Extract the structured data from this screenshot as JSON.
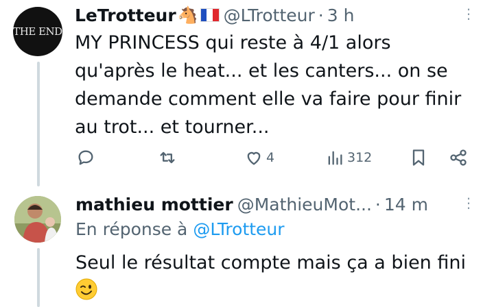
{
  "tweet1": {
    "avatar_text": "THE END",
    "display_name": "LeTrotteur",
    "name_emoji": "🐴",
    "handle": "@LTrotteur",
    "separator": "·",
    "time": "3 h",
    "more": "⋮",
    "text": "MY PRINCESS qui reste à 4/1 alors qu'après le heat... et les canters... on se demande comment elle va faire pour finir au trot... et tourner...",
    "actions": {
      "replies": "",
      "retweets": "",
      "likes": "4",
      "views": "312"
    }
  },
  "tweet2": {
    "display_name": "mathieu mottier",
    "handle": "@MathieuMot...",
    "separator": "·",
    "time": "14 m",
    "more": "⋮",
    "reply_prefix": "En réponse à",
    "reply_mention": "@LTrotteur",
    "text": "Seul le résultat compte mais ça a bien fini"
  },
  "colors": {
    "primary_text": "#0f1419",
    "secondary_text": "#536471",
    "link": "#1d9bf0",
    "thread_line": "#cfd9de"
  }
}
